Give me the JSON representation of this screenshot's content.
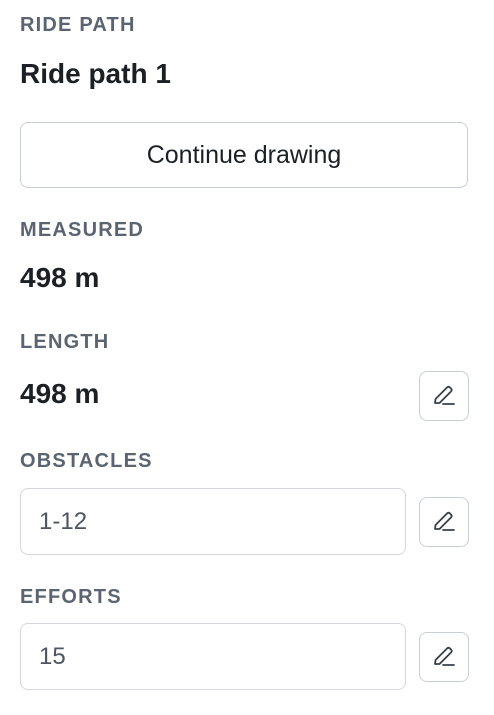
{
  "ride_path": {
    "section_label": "RIDE PATH",
    "name": "Ride path 1",
    "continue_label": "Continue drawing"
  },
  "measured": {
    "label": "MEASURED",
    "value": "498 m"
  },
  "length": {
    "label": "LENGTH",
    "value": "498 m",
    "edit_icon": "pencil-icon"
  },
  "obstacles": {
    "label": "OBSTACLES",
    "value": "1-12",
    "edit_icon": "pencil-icon"
  },
  "efforts": {
    "label": "EFFORTS",
    "value": "15",
    "edit_icon": "pencil-icon"
  },
  "colors": {
    "text_primary": "#1c1f24",
    "text_label": "#5b6470",
    "border": "#c9ced6"
  }
}
